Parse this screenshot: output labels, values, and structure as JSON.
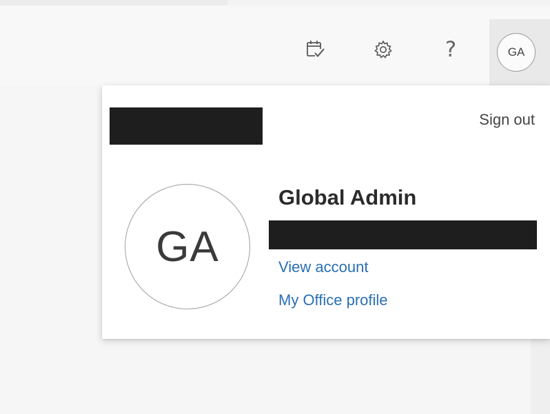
{
  "header": {
    "icons": {
      "calendar": "calendar-check-icon",
      "settings": "gear-icon",
      "help": "help-icon",
      "help_glyph": "?"
    },
    "avatar_initials": "GA"
  },
  "account_flyout": {
    "sign_out_label": "Sign out",
    "avatar_initials": "GA",
    "display_name": "Global Admin",
    "links": {
      "view_account": "View account",
      "office_profile": "My Office profile"
    }
  },
  "colors": {
    "link": "#2a6fb3",
    "text": "#2b2b2b",
    "redaction": "#1e1e1e"
  }
}
